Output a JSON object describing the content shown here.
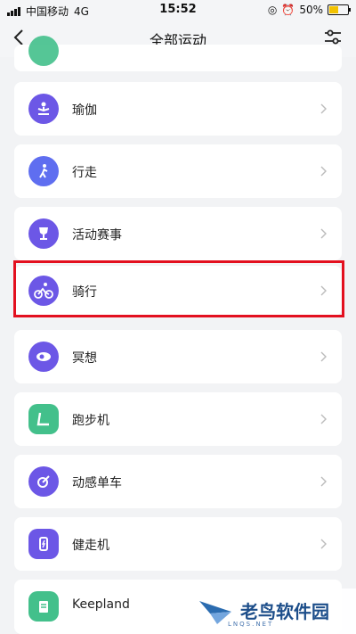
{
  "status_bar": {
    "carrier": "中国移动",
    "network": "4G",
    "time": "15:52",
    "battery_percent": "50%",
    "battery_level": 0.5
  },
  "header": {
    "title": "全部运动"
  },
  "items": [
    {
      "label": "",
      "icon": "partial-green-icon",
      "color": "#43c08b"
    },
    {
      "label": "瑜伽",
      "icon": "yoga-meditation-icon",
      "color": "#6c57e6"
    },
    {
      "label": "行走",
      "icon": "walking-person-icon",
      "color": "#6c57e6"
    },
    {
      "label": "活动赛事",
      "icon": "trophy-icon",
      "color": "#6c57e6"
    },
    {
      "label": "骑行",
      "icon": "cycling-icon",
      "color": "#6c57e6"
    },
    {
      "label": "冥想",
      "icon": "meditation-icon",
      "color": "#6c57e6"
    },
    {
      "label": "跑步机",
      "icon": "treadmill-icon",
      "color": "#43c08b"
    },
    {
      "label": "动感单车",
      "icon": "spin-bike-icon",
      "color": "#6c57e6"
    },
    {
      "label": "健走机",
      "icon": "walking-machine-icon",
      "color": "#6c57e6"
    },
    {
      "label": "Keepland",
      "icon": "keepland-icon",
      "color": "#43c08b"
    }
  ],
  "highlight_color": "#e3101f",
  "watermark": {
    "title": "老鸟软件园",
    "subtitle": "LNQS.NET"
  }
}
